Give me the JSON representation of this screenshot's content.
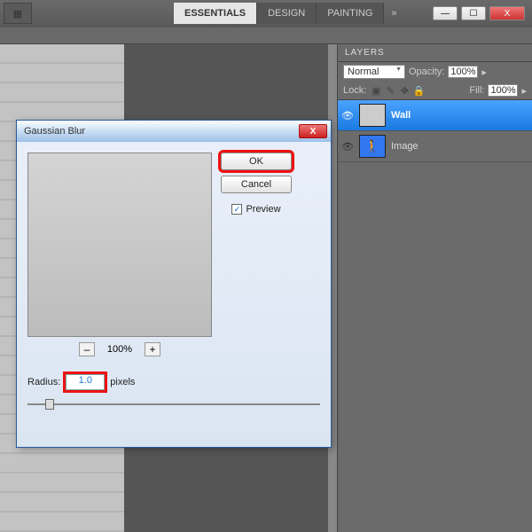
{
  "workspaces": {
    "essentials": "ESSENTIALS",
    "design": "DESIGN",
    "painting": "PAINTING",
    "more": "»"
  },
  "window_controls": {
    "min": "—",
    "max": "☐",
    "close": "X"
  },
  "layers_panel": {
    "title": "LAYERS",
    "blend_mode": "Normal",
    "opacity_label": "Opacity:",
    "opacity_value": "100%",
    "lock_label": "Lock:",
    "fill_label": "Fill:",
    "fill_value": "100%",
    "layers": [
      {
        "name": "Wall"
      },
      {
        "name": "Image"
      }
    ]
  },
  "dialog": {
    "title": "Gaussian Blur",
    "ok": "OK",
    "cancel": "Cancel",
    "preview": "Preview",
    "preview_checked": "✓",
    "zoom_out": "–",
    "zoom_pct": "100%",
    "zoom_in": "+",
    "radius_label": "Radius:",
    "radius_value": "1.0",
    "radius_unit": "pixels",
    "close_x": "X"
  }
}
